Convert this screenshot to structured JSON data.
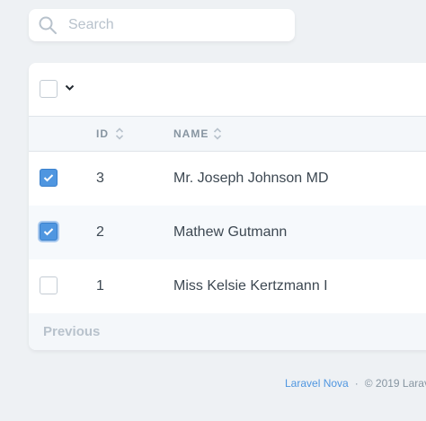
{
  "search": {
    "placeholder": "Search"
  },
  "table": {
    "columns": [
      {
        "label": "ID"
      },
      {
        "label": "NAME"
      }
    ],
    "rows": [
      {
        "id": "3",
        "name": "Mr. Joseph Johnson MD",
        "checked": true
      },
      {
        "id": "2",
        "name": "Mathew Gutmann",
        "checked": true
      },
      {
        "id": "1",
        "name": "Miss Kelsie Kertzmann I",
        "checked": false
      }
    ]
  },
  "pagination": {
    "previous_label": "Previous"
  },
  "footer": {
    "brand_link": "Laravel Nova",
    "separator": "·",
    "copyright": "© 2019 Larav"
  },
  "colors": {
    "accent": "#4f96e0",
    "background": "#eef1f4"
  }
}
